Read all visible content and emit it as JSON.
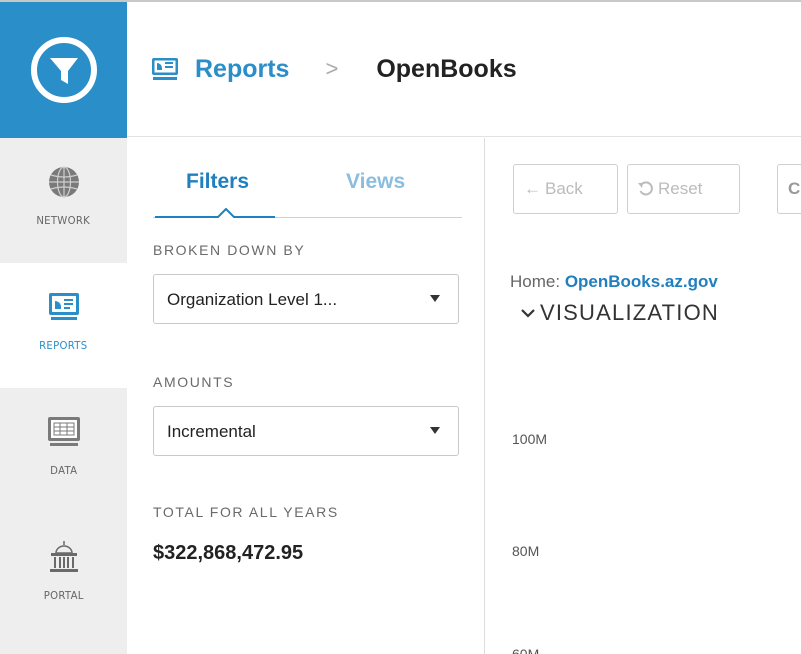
{
  "header": {
    "breadcrumb_root": "Reports",
    "breadcrumb_sep": ">",
    "breadcrumb_current": "OpenBooks"
  },
  "rail": {
    "items": [
      {
        "label": "NETWORK",
        "icon": "globe-icon"
      },
      {
        "label": "REPORTS",
        "icon": "reports-icon",
        "active": true
      },
      {
        "label": "DATA",
        "icon": "data-monitor-icon"
      },
      {
        "label": "PORTAL",
        "icon": "capitol-building-icon"
      }
    ]
  },
  "filters": {
    "tabs": {
      "filters": "Filters",
      "views": "Views"
    },
    "broken_down_by": {
      "label": "BROKEN DOWN BY",
      "value": "Organization Level 1..."
    },
    "amounts": {
      "label": "AMOUNTS",
      "value": "Incremental"
    },
    "total": {
      "label": "TOTAL FOR ALL YEARS",
      "value": "$322,868,472.95"
    }
  },
  "main": {
    "back_label": "Back",
    "reset_label": "Reset",
    "more_label": "C",
    "home_prefix": "Home:",
    "home_link": "OpenBooks.az.gov",
    "section_title": "VISUALIZATION",
    "y_ticks": [
      "100M",
      "80M",
      "60M"
    ]
  },
  "colors": {
    "accent": "#2a8ec9",
    "link": "#1f7fbf",
    "rail_bg": "#eeeeee"
  }
}
